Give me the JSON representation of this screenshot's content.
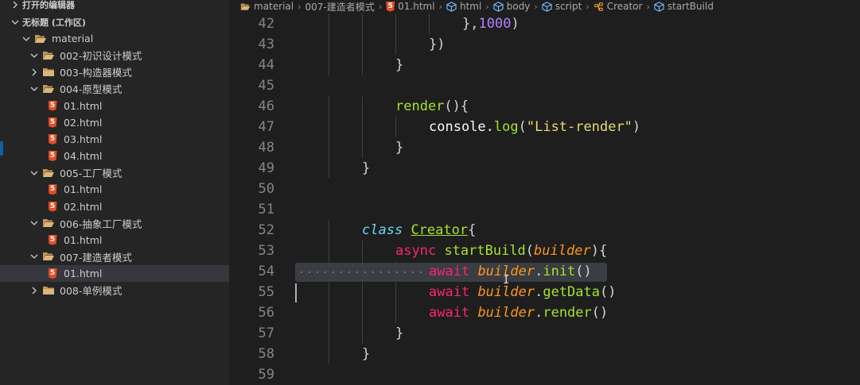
{
  "sidebar": {
    "open_editors_label": "打开的编辑器",
    "workspace_label": "无标题 (工作区)",
    "tree": [
      {
        "label": "material",
        "kind": "folder-open",
        "depth": 1,
        "expanded": true
      },
      {
        "label": "002-初识设计模式",
        "kind": "folder-open",
        "depth": 2,
        "expanded": true
      },
      {
        "label": "003-构造器模式",
        "kind": "folder",
        "depth": 2,
        "expanded": false
      },
      {
        "label": "004-原型模式",
        "kind": "folder-open",
        "depth": 2,
        "expanded": true
      },
      {
        "label": "01.html",
        "kind": "html",
        "depth": 3
      },
      {
        "label": "02.html",
        "kind": "html",
        "depth": 3
      },
      {
        "label": "03.html",
        "kind": "html",
        "depth": 3
      },
      {
        "label": "04.html",
        "kind": "html",
        "depth": 3
      },
      {
        "label": "005-工厂模式",
        "kind": "folder-open",
        "depth": 2,
        "expanded": true
      },
      {
        "label": "01.html",
        "kind": "html",
        "depth": 3
      },
      {
        "label": "02.html",
        "kind": "html",
        "depth": 3
      },
      {
        "label": "006-抽象工厂模式",
        "kind": "folder-open",
        "depth": 2,
        "expanded": true
      },
      {
        "label": "01.html",
        "kind": "html",
        "depth": 3
      },
      {
        "label": "007-建造者模式",
        "kind": "folder-open",
        "depth": 2,
        "expanded": true
      },
      {
        "label": "01.html",
        "kind": "html",
        "depth": 3,
        "selected": true
      },
      {
        "label": "008-单例模式",
        "kind": "folder",
        "depth": 2,
        "expanded": false
      }
    ]
  },
  "breadcrumb": [
    {
      "label": "material",
      "icon": "folder-icon"
    },
    {
      "label": "007-建造者模式",
      "icon": ""
    },
    {
      "label": "01.html",
      "icon": "html5-icon"
    },
    {
      "label": "html",
      "icon": "cube-icon"
    },
    {
      "label": "body",
      "icon": "cube-icon"
    },
    {
      "label": "script",
      "icon": "cube-icon"
    },
    {
      "label": "Creator",
      "icon": "class-icon"
    },
    {
      "label": "startBuild",
      "icon": "cube-icon"
    }
  ],
  "editor": {
    "lines": [
      {
        "num": "42",
        "tokens": [
          [
            "plain",
            "},"
          ],
          [
            "num2",
            "1000"
          ],
          [
            "plain",
            ")"
          ]
        ],
        "indent": 5
      },
      {
        "num": "43",
        "tokens": [
          [
            "plain",
            "})"
          ]
        ],
        "indent": 4
      },
      {
        "num": "44",
        "tokens": [
          [
            "plain",
            "}"
          ]
        ],
        "indent": 3
      },
      {
        "num": "45",
        "tokens": [],
        "indent": 0
      },
      {
        "num": "46",
        "tokens": [
          [
            "fn",
            "render"
          ],
          [
            "plain",
            "(){"
          ]
        ],
        "indent": 3
      },
      {
        "num": "47",
        "tokens": [
          [
            "white",
            "console."
          ],
          [
            "fn",
            "log"
          ],
          [
            "plain",
            "("
          ],
          [
            "str",
            "\"List-render\""
          ],
          [
            "plain",
            ")"
          ]
        ],
        "indent": 4
      },
      {
        "num": "48",
        "tokens": [
          [
            "plain",
            "}"
          ]
        ],
        "indent": 3
      },
      {
        "num": "49",
        "tokens": [
          [
            "plain",
            "}"
          ]
        ],
        "indent": 2
      },
      {
        "num": "50",
        "tokens": [],
        "indent": 0
      },
      {
        "num": "51",
        "tokens": [],
        "indent": 0
      },
      {
        "num": "52",
        "tokens": [
          [
            "kw",
            "class"
          ],
          [
            "plain",
            " "
          ],
          [
            "cls",
            "Creator"
          ],
          [
            "plain",
            "{"
          ]
        ],
        "indent": 2
      },
      {
        "num": "53",
        "tokens": [
          [
            "async",
            "async"
          ],
          [
            "plain",
            " "
          ],
          [
            "fn",
            "startBuild"
          ],
          [
            "plain",
            "("
          ],
          [
            "param",
            "builder"
          ],
          [
            "plain",
            "){"
          ]
        ],
        "indent": 3
      },
      {
        "num": "54",
        "tokens": [
          [
            "async",
            "await"
          ],
          [
            "plain",
            " "
          ],
          [
            "param",
            "builder"
          ],
          [
            "plain",
            "."
          ],
          [
            "fn",
            "init"
          ],
          [
            "plain",
            "()"
          ]
        ],
        "indent": 4
      },
      {
        "num": "55",
        "tokens": [
          [
            "async",
            "await"
          ],
          [
            "plain",
            " "
          ],
          [
            "param",
            "builder"
          ],
          [
            "plain",
            "."
          ],
          [
            "fn",
            "getData"
          ],
          [
            "plain",
            "()"
          ]
        ],
        "indent": 4
      },
      {
        "num": "56",
        "tokens": [
          [
            "async",
            "await"
          ],
          [
            "plain",
            " "
          ],
          [
            "param",
            "builder"
          ],
          [
            "plain",
            "."
          ],
          [
            "fn",
            "render"
          ],
          [
            "plain",
            "()"
          ]
        ],
        "indent": 4
      },
      {
        "num": "57",
        "tokens": [
          [
            "plain",
            "}"
          ]
        ],
        "indent": 3
      },
      {
        "num": "58",
        "tokens": [
          [
            "plain",
            "}"
          ]
        ],
        "indent": 2
      },
      {
        "num": "59",
        "tokens": [],
        "indent": 0
      }
    ]
  },
  "colors": {
    "background": "#1e1e1e",
    "sidebar": "#252526",
    "selection": "#37373d",
    "html_icon": "#e44d26",
    "folder_icon": "#c09553"
  }
}
